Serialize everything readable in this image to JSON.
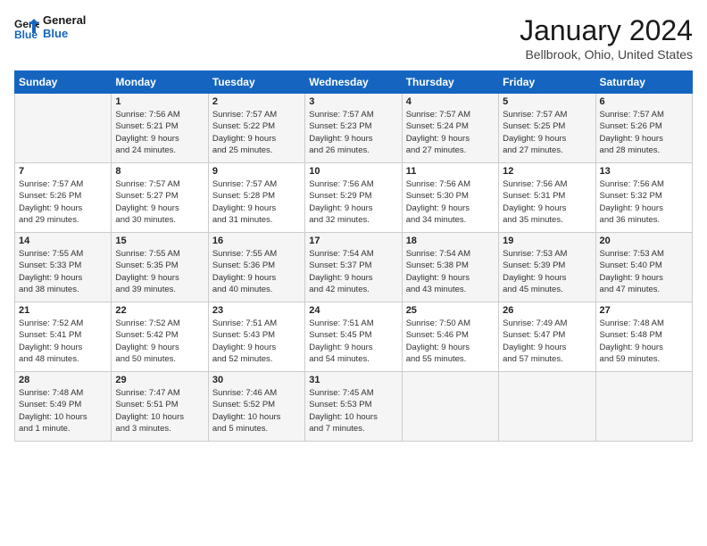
{
  "header": {
    "logo_line1": "General",
    "logo_line2": "Blue",
    "month_title": "January 2024",
    "location": "Bellbrook, Ohio, United States"
  },
  "weekdays": [
    "Sunday",
    "Monday",
    "Tuesday",
    "Wednesday",
    "Thursday",
    "Friday",
    "Saturday"
  ],
  "weeks": [
    [
      {
        "day": "",
        "detail": ""
      },
      {
        "day": "1",
        "detail": "Sunrise: 7:56 AM\nSunset: 5:21 PM\nDaylight: 9 hours\nand 24 minutes."
      },
      {
        "day": "2",
        "detail": "Sunrise: 7:57 AM\nSunset: 5:22 PM\nDaylight: 9 hours\nand 25 minutes."
      },
      {
        "day": "3",
        "detail": "Sunrise: 7:57 AM\nSunset: 5:23 PM\nDaylight: 9 hours\nand 26 minutes."
      },
      {
        "day": "4",
        "detail": "Sunrise: 7:57 AM\nSunset: 5:24 PM\nDaylight: 9 hours\nand 27 minutes."
      },
      {
        "day": "5",
        "detail": "Sunrise: 7:57 AM\nSunset: 5:25 PM\nDaylight: 9 hours\nand 27 minutes."
      },
      {
        "day": "6",
        "detail": "Sunrise: 7:57 AM\nSunset: 5:26 PM\nDaylight: 9 hours\nand 28 minutes."
      }
    ],
    [
      {
        "day": "7",
        "detail": "Sunrise: 7:57 AM\nSunset: 5:26 PM\nDaylight: 9 hours\nand 29 minutes."
      },
      {
        "day": "8",
        "detail": "Sunrise: 7:57 AM\nSunset: 5:27 PM\nDaylight: 9 hours\nand 30 minutes."
      },
      {
        "day": "9",
        "detail": "Sunrise: 7:57 AM\nSunset: 5:28 PM\nDaylight: 9 hours\nand 31 minutes."
      },
      {
        "day": "10",
        "detail": "Sunrise: 7:56 AM\nSunset: 5:29 PM\nDaylight: 9 hours\nand 32 minutes."
      },
      {
        "day": "11",
        "detail": "Sunrise: 7:56 AM\nSunset: 5:30 PM\nDaylight: 9 hours\nand 34 minutes."
      },
      {
        "day": "12",
        "detail": "Sunrise: 7:56 AM\nSunset: 5:31 PM\nDaylight: 9 hours\nand 35 minutes."
      },
      {
        "day": "13",
        "detail": "Sunrise: 7:56 AM\nSunset: 5:32 PM\nDaylight: 9 hours\nand 36 minutes."
      }
    ],
    [
      {
        "day": "14",
        "detail": "Sunrise: 7:55 AM\nSunset: 5:33 PM\nDaylight: 9 hours\nand 38 minutes."
      },
      {
        "day": "15",
        "detail": "Sunrise: 7:55 AM\nSunset: 5:35 PM\nDaylight: 9 hours\nand 39 minutes."
      },
      {
        "day": "16",
        "detail": "Sunrise: 7:55 AM\nSunset: 5:36 PM\nDaylight: 9 hours\nand 40 minutes."
      },
      {
        "day": "17",
        "detail": "Sunrise: 7:54 AM\nSunset: 5:37 PM\nDaylight: 9 hours\nand 42 minutes."
      },
      {
        "day": "18",
        "detail": "Sunrise: 7:54 AM\nSunset: 5:38 PM\nDaylight: 9 hours\nand 43 minutes."
      },
      {
        "day": "19",
        "detail": "Sunrise: 7:53 AM\nSunset: 5:39 PM\nDaylight: 9 hours\nand 45 minutes."
      },
      {
        "day": "20",
        "detail": "Sunrise: 7:53 AM\nSunset: 5:40 PM\nDaylight: 9 hours\nand 47 minutes."
      }
    ],
    [
      {
        "day": "21",
        "detail": "Sunrise: 7:52 AM\nSunset: 5:41 PM\nDaylight: 9 hours\nand 48 minutes."
      },
      {
        "day": "22",
        "detail": "Sunrise: 7:52 AM\nSunset: 5:42 PM\nDaylight: 9 hours\nand 50 minutes."
      },
      {
        "day": "23",
        "detail": "Sunrise: 7:51 AM\nSunset: 5:43 PM\nDaylight: 9 hours\nand 52 minutes."
      },
      {
        "day": "24",
        "detail": "Sunrise: 7:51 AM\nSunset: 5:45 PM\nDaylight: 9 hours\nand 54 minutes."
      },
      {
        "day": "25",
        "detail": "Sunrise: 7:50 AM\nSunset: 5:46 PM\nDaylight: 9 hours\nand 55 minutes."
      },
      {
        "day": "26",
        "detail": "Sunrise: 7:49 AM\nSunset: 5:47 PM\nDaylight: 9 hours\nand 57 minutes."
      },
      {
        "day": "27",
        "detail": "Sunrise: 7:48 AM\nSunset: 5:48 PM\nDaylight: 9 hours\nand 59 minutes."
      }
    ],
    [
      {
        "day": "28",
        "detail": "Sunrise: 7:48 AM\nSunset: 5:49 PM\nDaylight: 10 hours\nand 1 minute."
      },
      {
        "day": "29",
        "detail": "Sunrise: 7:47 AM\nSunset: 5:51 PM\nDaylight: 10 hours\nand 3 minutes."
      },
      {
        "day": "30",
        "detail": "Sunrise: 7:46 AM\nSunset: 5:52 PM\nDaylight: 10 hours\nand 5 minutes."
      },
      {
        "day": "31",
        "detail": "Sunrise: 7:45 AM\nSunset: 5:53 PM\nDaylight: 10 hours\nand 7 minutes."
      },
      {
        "day": "",
        "detail": ""
      },
      {
        "day": "",
        "detail": ""
      },
      {
        "day": "",
        "detail": ""
      }
    ]
  ]
}
